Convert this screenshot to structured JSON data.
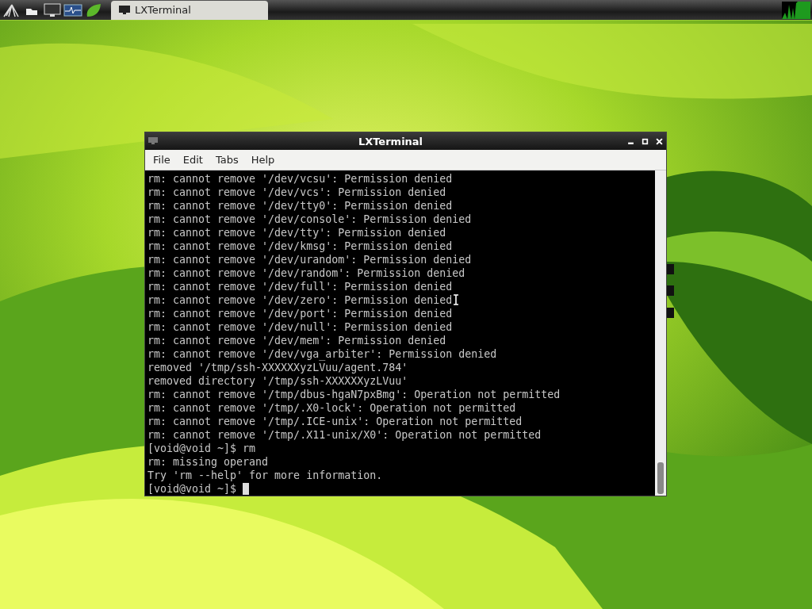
{
  "taskbar": {
    "task_buttons": [
      {
        "label": "LXTerminal",
        "selected": true
      }
    ]
  },
  "window": {
    "title": "LXTerminal",
    "menu": [
      "File",
      "Edit",
      "Tabs",
      "Help"
    ],
    "lines": [
      "rm: cannot remove '/dev/vcsu': Permission denied",
      "rm: cannot remove '/dev/vcs': Permission denied",
      "rm: cannot remove '/dev/tty0': Permission denied",
      "rm: cannot remove '/dev/console': Permission denied",
      "rm: cannot remove '/dev/tty': Permission denied",
      "rm: cannot remove '/dev/kmsg': Permission denied",
      "rm: cannot remove '/dev/urandom': Permission denied",
      "rm: cannot remove '/dev/random': Permission denied",
      "rm: cannot remove '/dev/full': Permission denied",
      "rm: cannot remove '/dev/zero': Permission denied",
      "rm: cannot remove '/dev/port': Permission denied",
      "rm: cannot remove '/dev/null': Permission denied",
      "rm: cannot remove '/dev/mem': Permission denied",
      "rm: cannot remove '/dev/vga_arbiter': Permission denied",
      "removed '/tmp/ssh-XXXXXXyzLVuu/agent.784'",
      "removed directory '/tmp/ssh-XXXXXXyzLVuu'",
      "rm: cannot remove '/tmp/dbus-hgaN7pxBmg': Operation not permitted",
      "rm: cannot remove '/tmp/.X0-lock': Operation not permitted",
      "rm: cannot remove '/tmp/.ICE-unix': Operation not permitted",
      "rm: cannot remove '/tmp/.X11-unix/X0': Operation not permitted",
      "[void@void ~]$ rm",
      "rm: missing operand",
      "Try 'rm --help' for more information."
    ],
    "prompt": "[void@void ~]$"
  }
}
